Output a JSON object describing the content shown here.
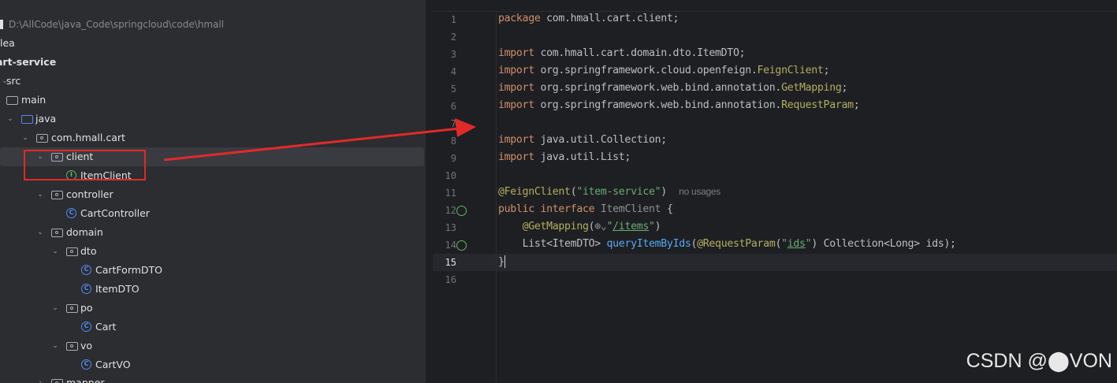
{
  "project_tree": {
    "root_path": "D:\\AllCode\\java_Code\\springcloud\\code\\hmall",
    "items": [
      {
        "label": "idea",
        "shown": "lea"
      },
      {
        "label": "art-service"
      },
      {
        "label": "src"
      },
      {
        "label": "main"
      },
      {
        "label": "java"
      },
      {
        "label": "com.hmall.cart"
      },
      {
        "label": "client"
      },
      {
        "label": "ItemClient"
      },
      {
        "label": "controller"
      },
      {
        "label": "CartController"
      },
      {
        "label": "domain"
      },
      {
        "label": "dto"
      },
      {
        "label": "CartFormDTO"
      },
      {
        "label": "ItemDTO"
      },
      {
        "label": "po"
      },
      {
        "label": "Cart"
      },
      {
        "label": "vo"
      },
      {
        "label": "CartVO"
      },
      {
        "label": "mapper"
      }
    ]
  },
  "editor": {
    "line_numbers": [
      "1",
      "2",
      "3",
      "4",
      "5",
      "6",
      "7",
      "8",
      "9",
      "10",
      "11",
      "12",
      "13",
      "14",
      "15",
      "16"
    ],
    "current_line": "15",
    "code": {
      "l1_kw": "package",
      "l1_rest": " com.hmall.cart.client;",
      "l3_kw": "import",
      "l3_rest": " com.hmall.cart.domain.dto.ItemDTO;",
      "l4_kw": "import",
      "l4_rest": " org.springframework.cloud.openfeign.",
      "l4_an": "FeignClient",
      "l4_end": ";",
      "l5_kw": "import",
      "l5_rest": " org.springframework.web.bind.annotation.",
      "l5_an": "GetMapping",
      "l5_end": ";",
      "l6_kw": "import",
      "l6_rest": " org.springframework.web.bind.annotation.",
      "l6_an": "RequestParam",
      "l6_end": ";",
      "l8_kw": "import",
      "l8_rest": " java.util.Collection;",
      "l9_kw": "import",
      "l9_rest": " java.util.List;",
      "l11_an": "@FeignClient",
      "l11_p1": "(",
      "l11_str": "\"item-service\"",
      "l11_p2": ")",
      "l11_hint": "no usages",
      "l12_kw1": "public",
      "l12_kw2": "interface",
      "l12_name": "ItemClient",
      "l12_brace": "{",
      "l13_an": "@GetMapping",
      "l13_p1": "(",
      "l13_globe": "⊕⌄",
      "l13_str_q1": "\"",
      "l13_str": "/items",
      "l13_str_q2": "\"",
      "l13_p2": ")",
      "l14_t1": "List<ItemDTO> ",
      "l14_fn": "queryItemByIds",
      "l14_p1": "(",
      "l14_an": "@RequestParam",
      "l14_p2": "(",
      "l14_q1": "\"",
      "l14_str": "ids",
      "l14_q2": "\"",
      "l14_rest": ") Collection<Long> ids);",
      "l15": "}"
    }
  },
  "watermark": "CSDN @⬤VON",
  "colors": {
    "annotation_box": "#e02a2a",
    "arrow": "#e02a2a",
    "keyword": "#cf8e6d",
    "annotation": "#b3ae60",
    "string": "#6aab73",
    "method": "#56a8f5"
  }
}
